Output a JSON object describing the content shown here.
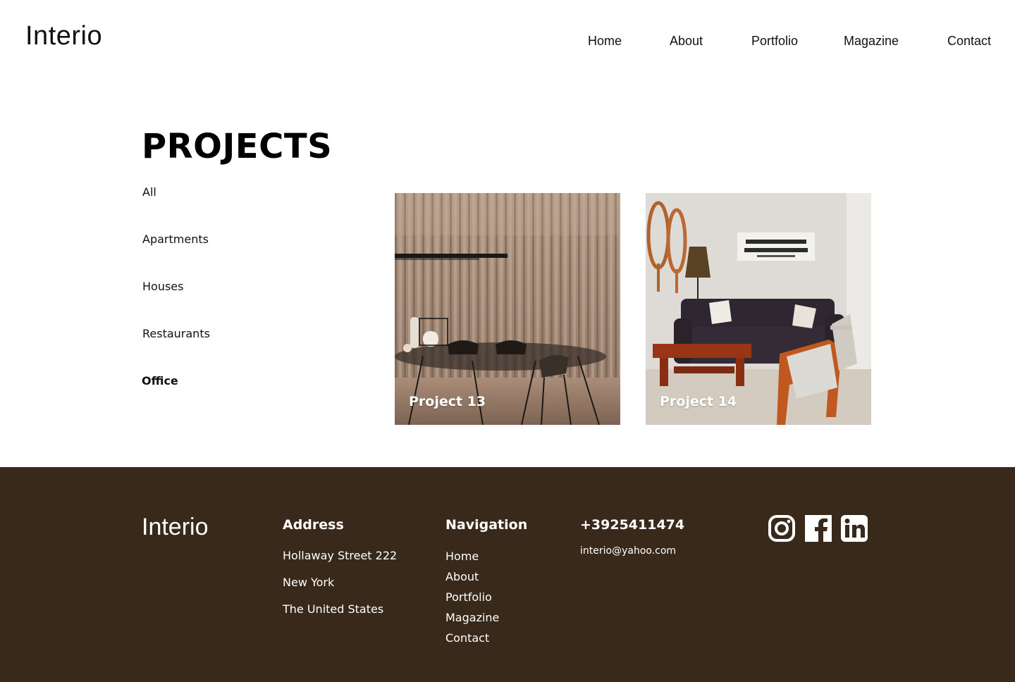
{
  "header": {
    "logo": "Interio",
    "nav": [
      "Home",
      "About",
      "Portfolio",
      "Magazine",
      "Contact"
    ]
  },
  "projects": {
    "heading": "PROJECTS",
    "filters": [
      {
        "label": "All",
        "active": false
      },
      {
        "label": "Apartments",
        "active": false
      },
      {
        "label": "Houses",
        "active": false
      },
      {
        "label": "Restaurants",
        "active": false
      },
      {
        "label": "Office",
        "active": true
      }
    ],
    "cards": [
      {
        "title": "Project 13"
      },
      {
        "title": "Project 14"
      }
    ]
  },
  "footer": {
    "logo": "Interio",
    "address": {
      "heading": "Address",
      "lines": [
        "Hollaway Street 222",
        "New York",
        "The United States"
      ]
    },
    "navigation": {
      "heading": "Navigation",
      "links": [
        "Home",
        "About",
        "Portfolio",
        "Magazine",
        "Contact"
      ]
    },
    "contact": {
      "phone": "+3925411474",
      "email": "interio@yahoo.com"
    },
    "social": [
      "instagram-icon",
      "facebook-icon",
      "linkedin-icon"
    ],
    "background_color": "#38291b"
  }
}
